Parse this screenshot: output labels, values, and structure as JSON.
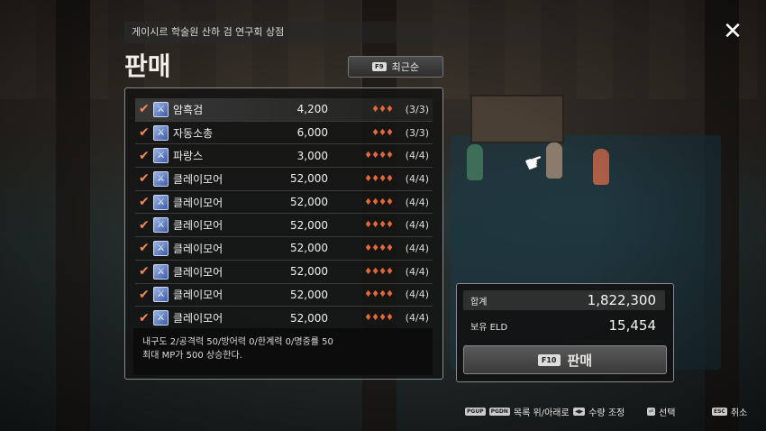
{
  "header": {
    "breadcrumb": "게이시르 학술원 산하 검 연구회 상점",
    "title": "판매",
    "close_icon": "close-icon"
  },
  "sort": {
    "key": "F9",
    "label": "최근순"
  },
  "items": [
    {
      "name": "암흑검",
      "price": "4,200",
      "grade": "♦♦♦",
      "count": "(3/3)"
    },
    {
      "name": "자동소총",
      "price": "6,000",
      "grade": "♦♦♦",
      "count": "(3/3)"
    },
    {
      "name": "파랑스",
      "price": "3,000",
      "grade": "♦♦♦♦",
      "count": "(4/4)"
    },
    {
      "name": "클레이모어",
      "price": "52,000",
      "grade": "♦♦♦♦",
      "count": "(4/4)"
    },
    {
      "name": "클레이모어",
      "price": "52,000",
      "grade": "♦♦♦♦",
      "count": "(4/4)"
    },
    {
      "name": "클레이모어",
      "price": "52,000",
      "grade": "♦♦♦♦",
      "count": "(4/4)"
    },
    {
      "name": "클레이모어",
      "price": "52,000",
      "grade": "♦♦♦♦",
      "count": "(4/4)"
    },
    {
      "name": "클레이모어",
      "price": "52,000",
      "grade": "♦♦♦♦",
      "count": "(4/4)"
    },
    {
      "name": "클레이모어",
      "price": "52,000",
      "grade": "♦♦♦♦",
      "count": "(4/4)"
    },
    {
      "name": "클레이모어",
      "price": "52,000",
      "grade": "♦♦♦♦",
      "count": "(4/4)"
    }
  ],
  "description": {
    "line1": "내구도 2/공격력 50/방어력 0/한계력 0/명중률 50",
    "line2": "최대 MP가 500 상승한다."
  },
  "summary": {
    "total_label": "합계",
    "total_value": "1,822,300",
    "eld_label": "보유 ELD",
    "eld_value": "15,454",
    "sell_key": "F10",
    "sell_label": "판매"
  },
  "footer": {
    "list_keys": [
      "PGUP",
      "PGDN"
    ],
    "list_label": "목록 위/아래로",
    "qty_label": "수량 조정",
    "select_label": "선택",
    "cancel_key": "ESC",
    "cancel_label": "취소"
  },
  "colors": {
    "accent": "#e06a3c",
    "check": "#f08a5a",
    "panel_border": "#8a8a8a"
  }
}
